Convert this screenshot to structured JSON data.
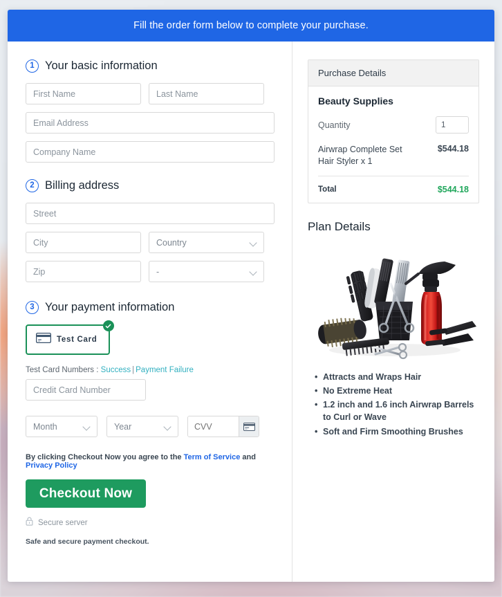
{
  "banner": {
    "message": "Fill the order form below to complete your purchase."
  },
  "steps": {
    "basic": {
      "number": "1",
      "title": "Your basic information",
      "fields": {
        "first_name_placeholder": "First Name",
        "last_name_placeholder": "Last Name",
        "email_placeholder": "Email Address",
        "company_placeholder": "Company Name",
        "first_name_value": "",
        "last_name_value": "",
        "email_value": "",
        "company_value": ""
      }
    },
    "billing": {
      "number": "2",
      "title": "Billing address",
      "fields": {
        "street_placeholder": "Street",
        "city_placeholder": "City",
        "zip_placeholder": "Zip",
        "street_value": "",
        "city_value": "",
        "zip_value": "",
        "country_selected": "Country",
        "state_selected": "-"
      }
    },
    "payment": {
      "number": "3",
      "title": "Your payment information",
      "method_tile": {
        "label": "Test  Card",
        "icon": "credit-card-icon",
        "selected": true,
        "selected_badge_icon": "check-circle-icon",
        "border_color": "#1a9158"
      },
      "test_numbers": {
        "prefix": "Test Card Numbers : ",
        "success_label": "Success",
        "separator": "|",
        "failure_label": "Payment Failure",
        "link_color": "#32b0c0"
      },
      "card_number_placeholder": "Credit Card Number",
      "card_number_value": "",
      "month_selected": "Month",
      "year_selected": "Year",
      "cvv_placeholder": "CVV",
      "cvv_value": "",
      "cvv_icon": "credit-card-icon"
    }
  },
  "terms": {
    "prefix": "By clicking Checkout Now you agree to the ",
    "tos_label": "Term of Service",
    "conjunction": " and ",
    "privacy_label": "Privacy Policy",
    "link_color": "#1f66e5"
  },
  "checkout": {
    "button_label": "Checkout Now",
    "button_color": "#1e9b5f",
    "secure_icon": "lock-icon",
    "secure_label": "Secure server",
    "safe_note": "Safe and secure payment checkout."
  },
  "purchase_details": {
    "panel_title": "Purchase Details",
    "product_group": "Beauty Supplies",
    "quantity_label": "Quantity",
    "quantity_value": "1",
    "line_items": [
      {
        "name": "Airwrap Complete Set Hair Styler x 1",
        "price": "$544.18"
      }
    ],
    "total_label": "Total",
    "total_value": "$544.18",
    "total_color": "#21a75c"
  },
  "plan_details": {
    "title": "Plan Details",
    "image_alt": "hair-styling-tools-photo",
    "features": [
      "Attracts and Wraps Hair",
      "No Extreme Heat",
      "1.2 inch and 1.6 inch Airwrap Barrels to Curl or Wave",
      "Soft and Firm Smoothing Brushes"
    ]
  },
  "theme": {
    "banner_blue": "#1f66e5",
    "accent_green": "#1e9b5f",
    "link_teal": "#32b0c0",
    "link_blue": "#1f66e5"
  }
}
